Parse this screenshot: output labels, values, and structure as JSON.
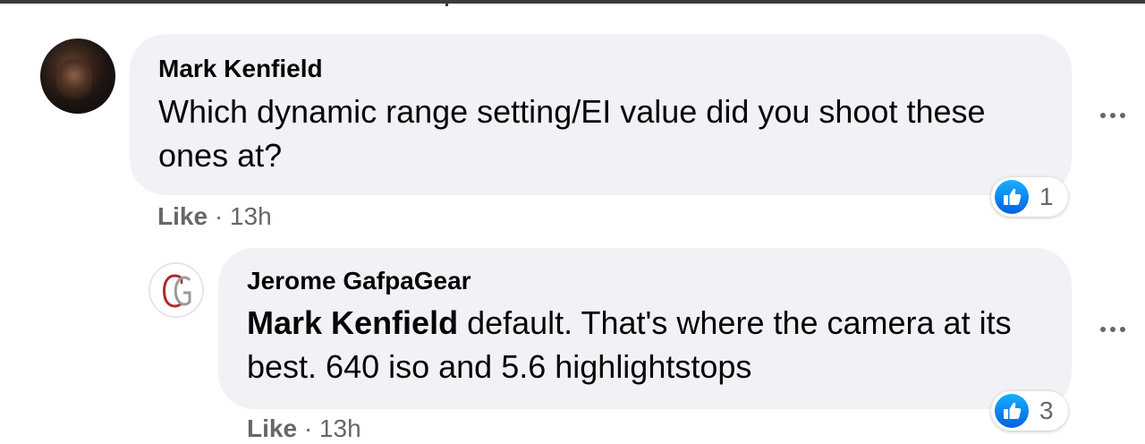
{
  "comments": [
    {
      "author": "Mark Kenfield",
      "mention": "",
      "text": "Which dynamic range setting/EI value did you shoot these ones at?",
      "like_label": "Like",
      "separator": "·",
      "time": "13h",
      "reaction_icon": "thumbs-up-icon",
      "reaction_count": "1"
    },
    {
      "author": "Jerome GafpaGear",
      "mention": "Mark Kenfield",
      "text": " default. That's where the camera at its best. 640 iso and 5.6 highlightstops",
      "like_label": "Like",
      "separator": "·",
      "time": "13h",
      "reaction_icon": "thumbs-up-icon",
      "reaction_count": "3"
    }
  ],
  "colors": {
    "bubble": "#f0f2f5",
    "meta_text": "#65676b",
    "like_badge": "#1877f2"
  }
}
